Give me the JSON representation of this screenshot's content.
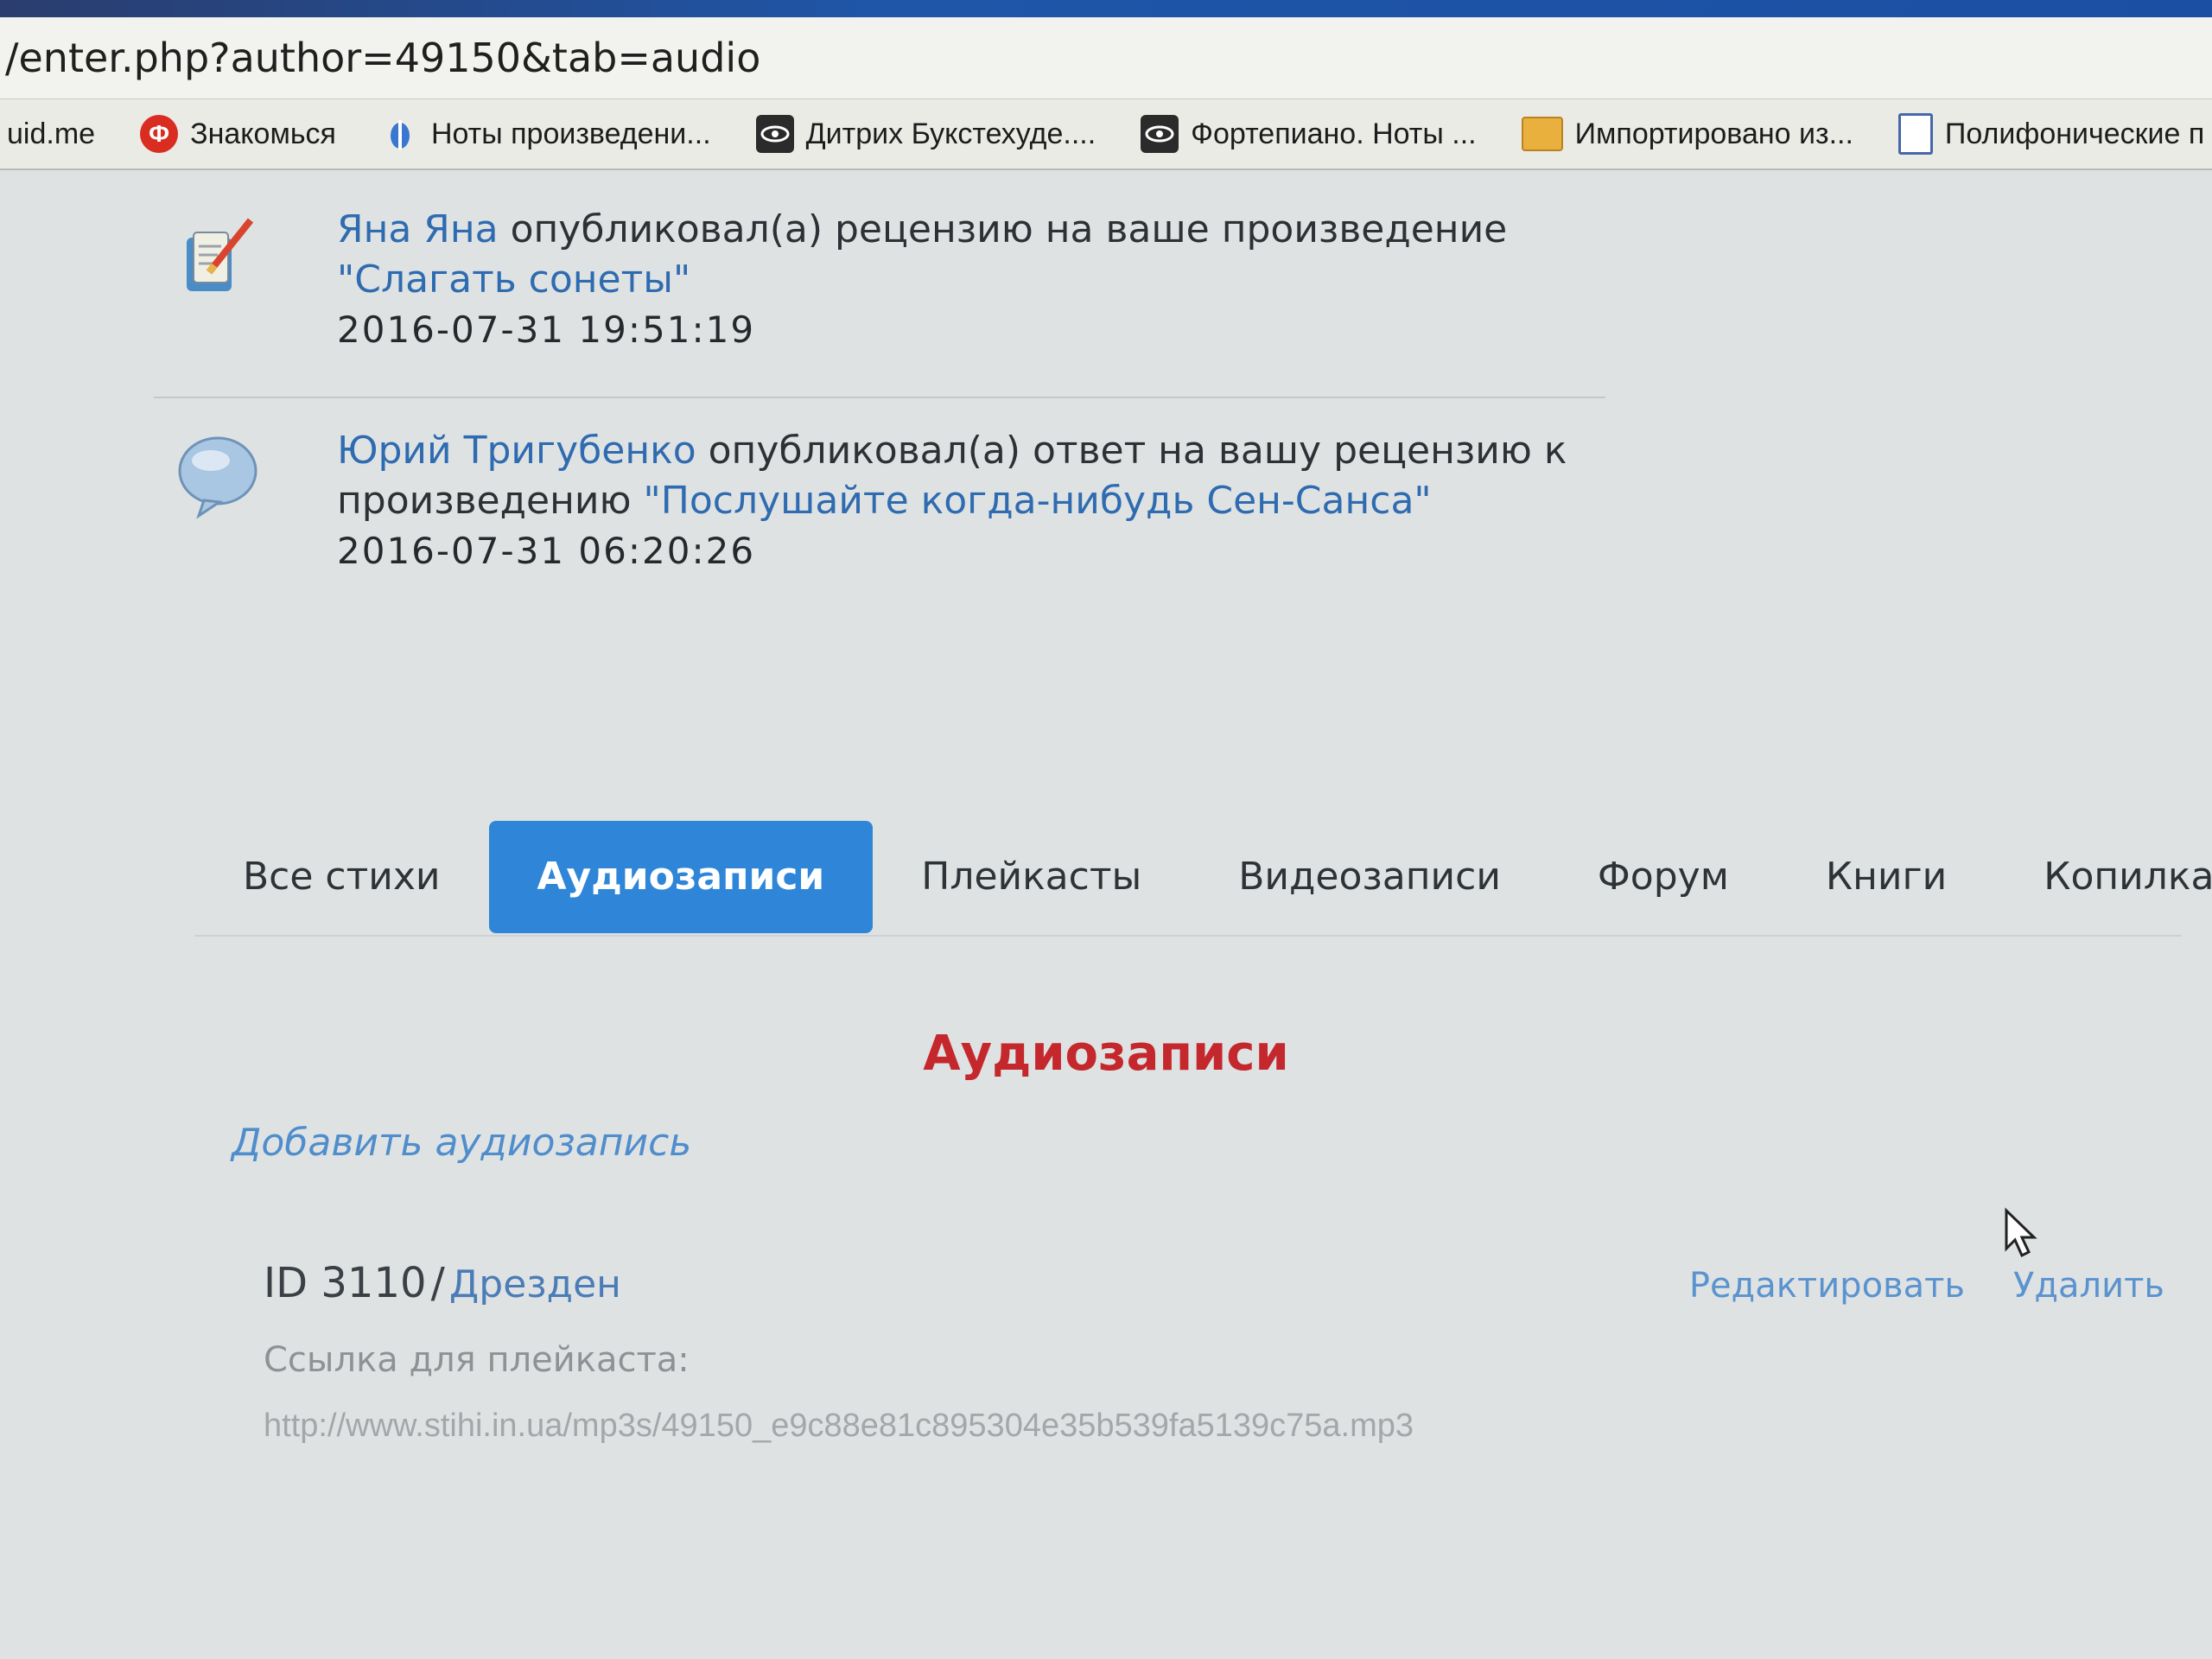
{
  "browser": {
    "address": "/enter.php?author=49150&tab=audio",
    "bookmarks": [
      {
        "label": "uid.me",
        "icon": "none"
      },
      {
        "label": "Знакомься",
        "icon": "odnoklassniki-icon"
      },
      {
        "label": "Ноты произведени...",
        "icon": "blue-drop-icon"
      },
      {
        "label": "Дитрих Букстехуде....",
        "icon": "eye-icon"
      },
      {
        "label": "Фортепиано. Ноты ...",
        "icon": "eye-icon"
      },
      {
        "label": "Импортировано из...",
        "icon": "folder-icon"
      },
      {
        "label": "Полифонические п",
        "icon": "document-icon"
      }
    ]
  },
  "notifications": [
    {
      "author": "Яна Яна",
      "action": "опубликовал(а) рецензию на ваше произведение",
      "work": "\"Слагать сонеты\"",
      "timestamp": "2016-07-31 19:51:19",
      "icon": "review-pencil-icon"
    },
    {
      "author": "Юрий Тригубенко",
      "action": "опубликовал(а) ответ на вашу рецензию к произведению",
      "work": "\"Послушайте когда-нибудь Сен-Санса\"",
      "timestamp": "2016-07-31 06:20:26",
      "icon": "speech-bubble-icon"
    }
  ],
  "tabs": [
    {
      "label": "Все стихи",
      "active": false
    },
    {
      "label": "Аудиозаписи",
      "active": true
    },
    {
      "label": "Плейкасты",
      "active": false
    },
    {
      "label": "Видеозаписи",
      "active": false
    },
    {
      "label": "Форум",
      "active": false
    },
    {
      "label": "Книги",
      "active": false
    },
    {
      "label": "Копилка",
      "active": false
    }
  ],
  "section": {
    "title": "Аудиозаписи",
    "add_link": "Добавить аудиозапись"
  },
  "audio_items": [
    {
      "id_label": "ID 3110",
      "separator": "/",
      "name": "Дрезден",
      "edit_label": "Редактировать",
      "delete_label": "Удалить",
      "caption": "Ссылка для плейкаста:",
      "url": "http://www.stihi.in.ua/mp3s/49150_e9c88e81c895304e35b539fa5139c75a.mp3"
    }
  ],
  "colors": {
    "accent": "#2f86d8",
    "link": "#2e6bb0",
    "title_red": "#c4282d"
  }
}
